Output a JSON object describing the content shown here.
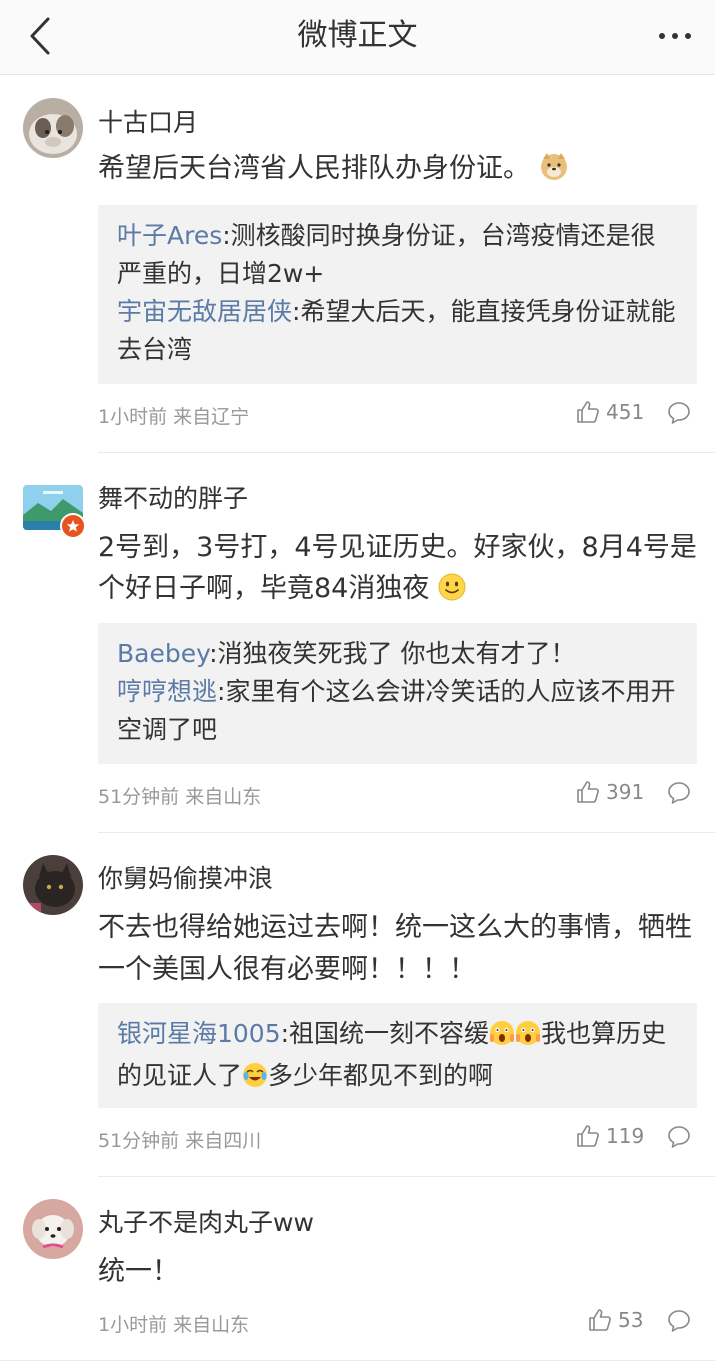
{
  "header": {
    "title": "微博正文"
  },
  "comments": [
    {
      "username": "十古口月",
      "text": "希望后天台湾省人民排队办身份证。",
      "text_emoji": "doge-emoji",
      "replies": [
        {
          "name": "叶子Ares",
          "text": ":测核酸同时换身份证，台湾疫情还是很严重的，日增2w+"
        },
        {
          "name": "宇宙无敌居居侠",
          "text": ":希望大后天，能直接凭身份证就能去台湾"
        }
      ],
      "time": "1小时前",
      "source": "来自辽宁",
      "likes": "451"
    },
    {
      "username": "舞不动的胖子",
      "text": "2号到，3号打，4号见证历史。好家伙，8月4号是个好日子啊，毕竟84消独夜",
      "text_emoji": "smile-emoji",
      "replies": [
        {
          "name": "Baebey",
          "text": ":消独夜笑死我了 你也太有才了！"
        },
        {
          "name": "哼哼想逃",
          "text": ":家里有个这么会讲冷笑话的人应该不用开空调了吧"
        }
      ],
      "time": "51分钟前",
      "source": "来自山东",
      "likes": "391"
    },
    {
      "username": "你舅妈偷摸冲浪",
      "text": "不去也得给她运过去啊！统一这么大的事情，牺牲一个美国人很有必要啊！！！！",
      "replies": [
        {
          "name": "银河星海1005",
          "text_parts": [
            ":祖国统一刻不容缓",
            "我也算历史的见证人了",
            "多少年都见不到的啊"
          ]
        }
      ],
      "time": "51分钟前",
      "source": "来自四川",
      "likes": "119"
    },
    {
      "username": "丸子不是肉丸子ww",
      "text": "统一！",
      "time": "1小时前",
      "source": "来自山东",
      "likes": "53"
    }
  ],
  "colors": {
    "reply_name": "#5b7ba6",
    "meta": "#999999",
    "reply_bg": "#f2f2f2"
  }
}
